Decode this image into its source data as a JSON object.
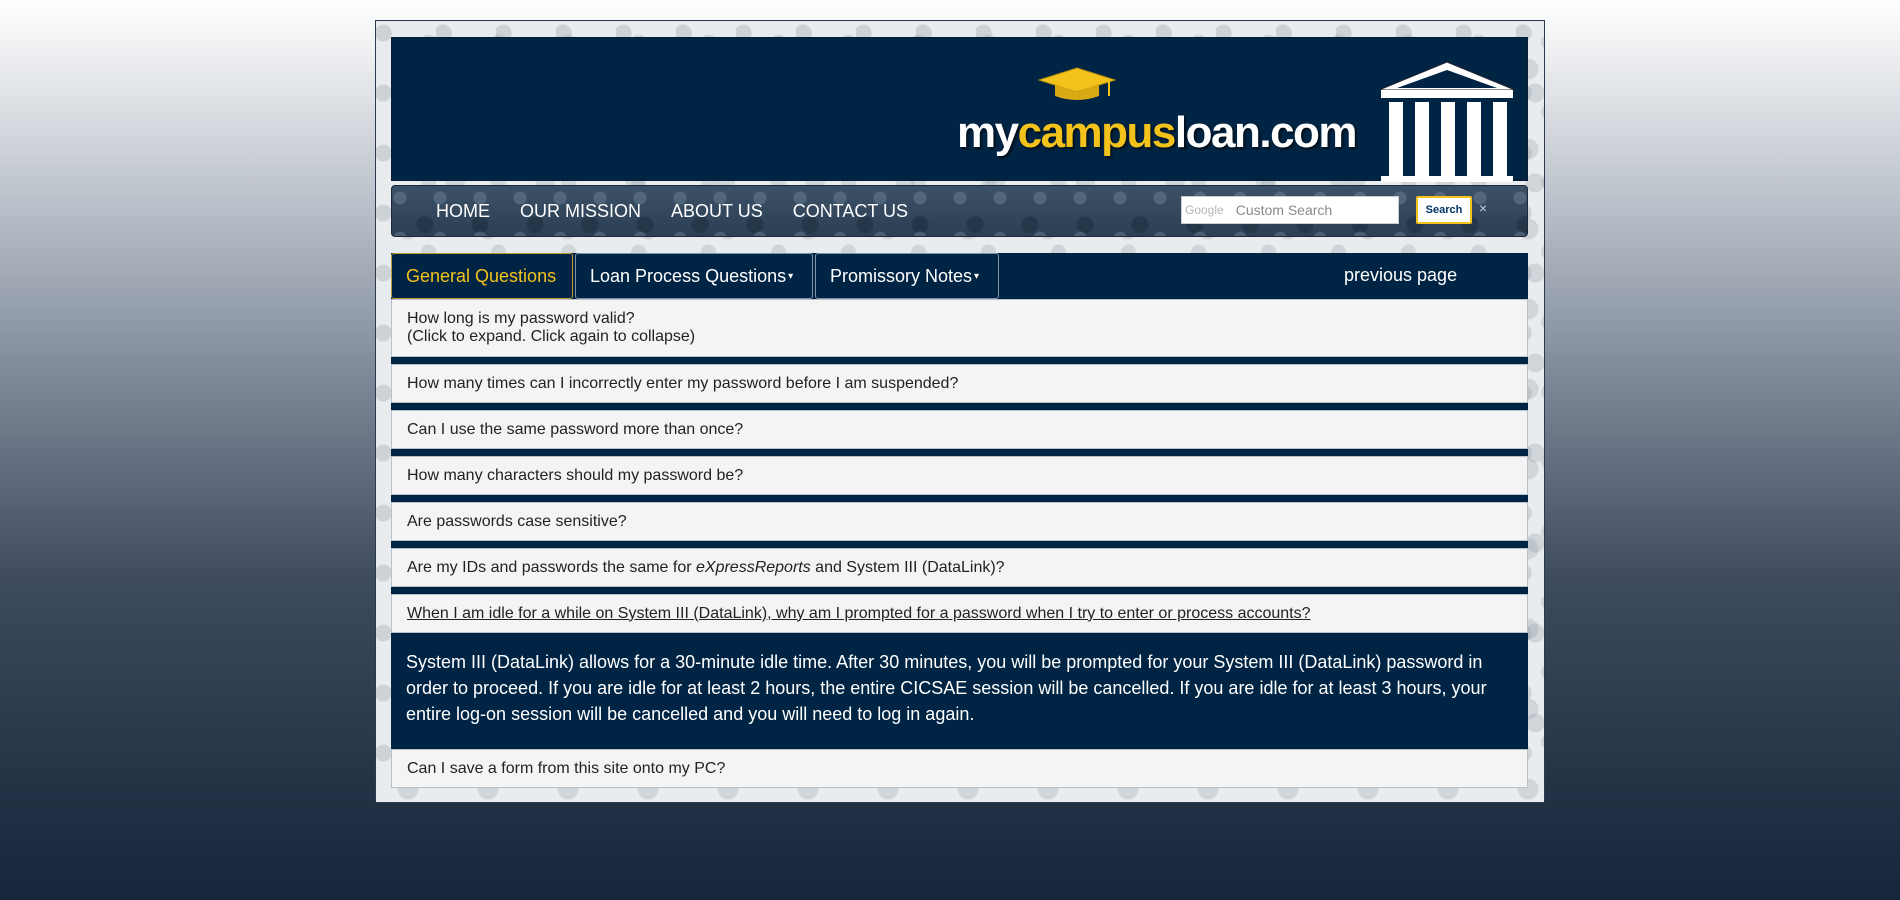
{
  "brand": {
    "logo_prefix": "my",
    "logo_accent": "campus",
    "logo_suffix": "loan.com"
  },
  "nav": {
    "links": [
      "HOME",
      "OUR MISSION",
      "ABOUT US",
      "CONTACT US"
    ],
    "search_provider": "Google",
    "search_placeholder": "Custom Search",
    "search_button": "Search",
    "clear": "×"
  },
  "tabs": {
    "general": "General Questions",
    "loan_process": "Loan Process Questions",
    "promissory": "Promissory Notes",
    "caret": "▾",
    "previous_page": "previous page"
  },
  "faq": {
    "q1_line1": "How long is my password valid?",
    "q1_line2": "(Click to expand. Click again to collapse)",
    "q2": "How many times can I incorrectly enter my password before I am suspended?",
    "q3": "Can I use the same password more than once?",
    "q4": "How many characters should my password be?",
    "q5": "Are passwords case sensitive?",
    "q6_pre": "Are my IDs and passwords the same for ",
    "q6_italic": "eXpressReports",
    "q6_post": " and System III (DataLink)?",
    "q7": "When I am idle for a while on System III (DataLink), why am I prompted for a password when I try to enter or process accounts?",
    "a7": "System III (DataLink) allows for a 30-minute idle time. After 30 minutes, you will be prompted for your System III (DataLink) password in order to proceed. If you are idle for at least 2 hours, the entire CICSAE session will be cancelled. If you are idle for at least 3 hours, your entire log-on session will be cancelled and you will need to log in again.",
    "q8": "Can I save a form from this site onto my PC?"
  },
  "colors": {
    "navy": "#002544",
    "gold": "#f3c21b"
  }
}
